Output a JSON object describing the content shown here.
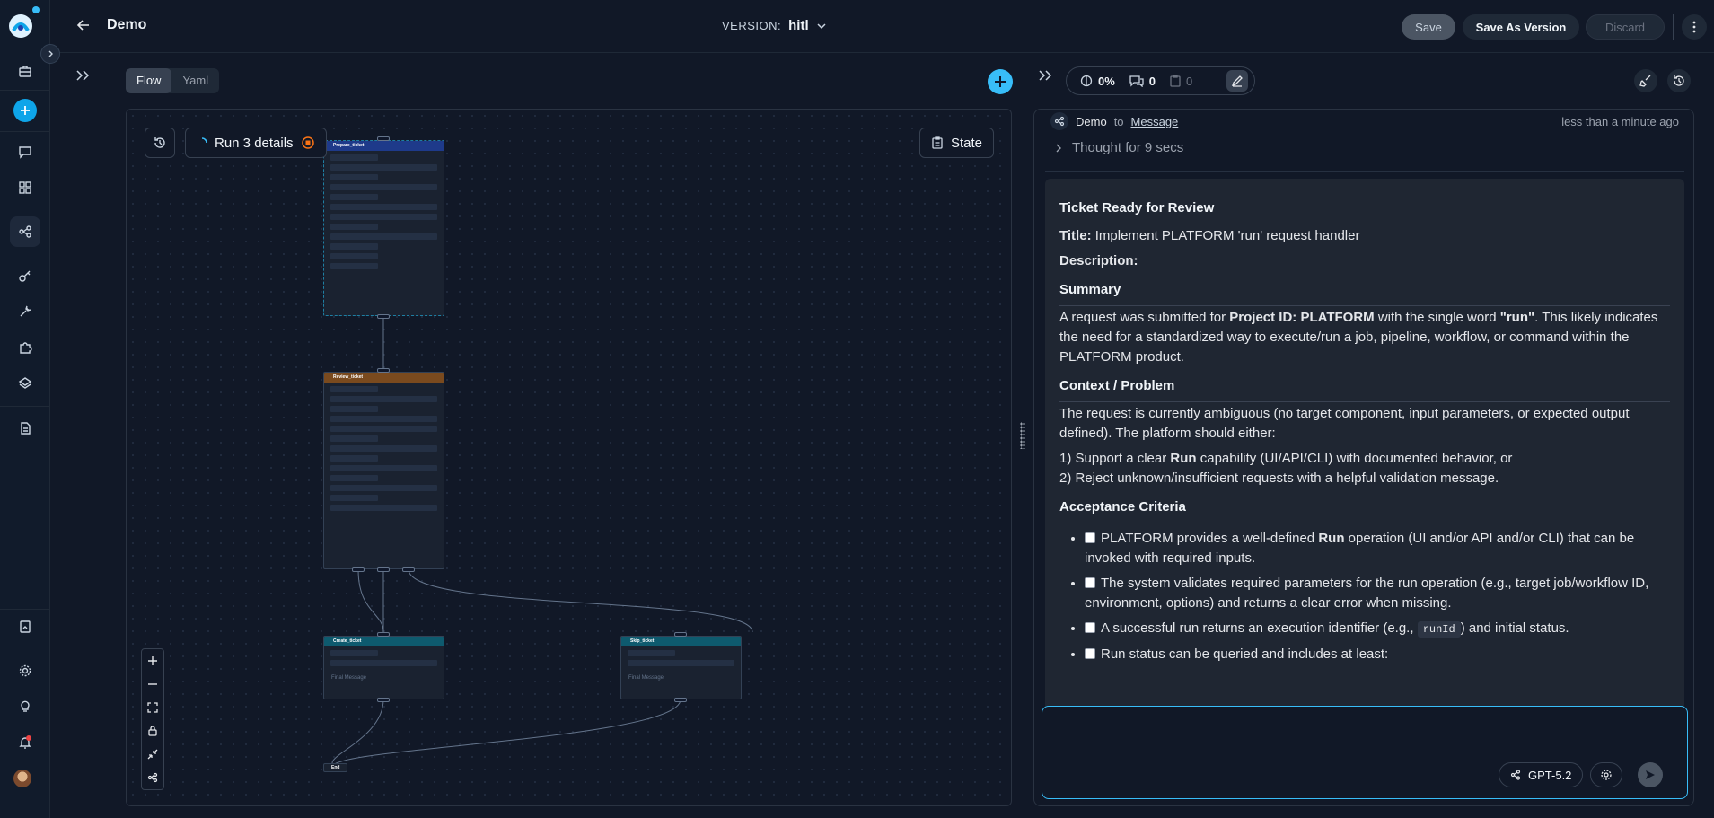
{
  "app": {
    "title": "Demo"
  },
  "version": {
    "label": "VERSION:",
    "value": "hitl"
  },
  "toolbar": {
    "save": "Save",
    "save_as_version": "Save As Version",
    "discard": "Discard"
  },
  "canvas": {
    "tabs": [
      {
        "label": "Flow",
        "active": true
      },
      {
        "label": "Yaml",
        "active": false
      }
    ],
    "run_details": "Run 3 details",
    "state_label": "State",
    "nodes": {
      "prepare": "Prepare_ticket",
      "review": "Review_ticket",
      "create": "Create_ticket",
      "skip": "Skip_ticket",
      "end": "End",
      "final_message": "Final Message"
    }
  },
  "stats": {
    "progress": "0%",
    "comments": "0",
    "tasks": "0"
  },
  "message": {
    "from": "Demo",
    "to_word": "to",
    "target": "Message",
    "time": "less than a minute ago",
    "thought": "Thought for 9 secs",
    "heading": "Ticket Ready for Review",
    "title_label": "Title:",
    "title_value": "Implement PLATFORM 'run' request handler",
    "description_label": "Description:",
    "summary_heading": "Summary",
    "summary": {
      "t1": "A request was submitted for ",
      "b1": "Project ID: PLATFORM",
      "t2": " with the single word ",
      "b2": "\"run\"",
      "t3": ". This likely indicates the need for a standardized way to execute/run a job, pipeline, workflow, or command within the PLATFORM product."
    },
    "context_heading": "Context / Problem",
    "context_text": "The request is currently ambiguous (no target component, input parameters, or expected output defined). The platform should either:",
    "option1": {
      "t1": "1) Support a clear ",
      "b": "Run",
      "t2": " capability (UI/API/CLI) with documented behavior, or"
    },
    "option2": "2) Reject unknown/insufficient requests with a helpful validation message.",
    "acceptance_heading": "Acceptance Criteria",
    "criteria": {
      "c1": {
        "t1": "PLATFORM provides a well-defined ",
        "b": "Run",
        "t2": " operation (UI and/or API and/or CLI) that can be invoked with required inputs."
      },
      "c2": "The system validates required parameters for the run operation (e.g., target job/workflow ID, environment, options) and returns a clear error when missing.",
      "c3": {
        "t1": "A successful run returns an execution identifier (e.g., ",
        "code": "runId",
        "t2": ") and initial status."
      },
      "c4": "Run status can be queried and includes at least:"
    }
  },
  "input": {
    "model": "GPT-5.2"
  },
  "colors": {
    "accent": "#38bdf8",
    "review_header": "#7a4a1e",
    "create_header": "#0e5a6e",
    "prepare_header": "#1e3a8a"
  }
}
